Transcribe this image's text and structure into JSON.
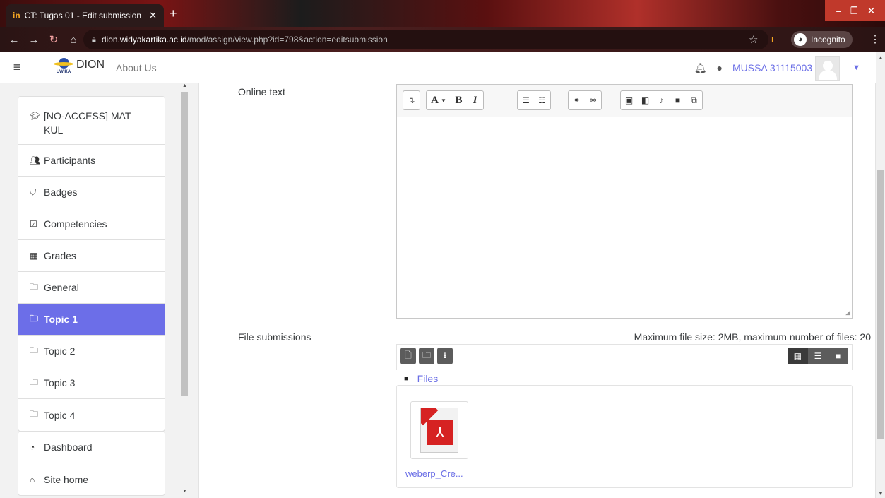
{
  "browser": {
    "tab_title": "CT: Tugas 01 - Edit submission",
    "tab_favicon": "in",
    "url_host": "dion.widyakartika.ac.id",
    "url_path": "/mod/assign/view.php?id=798&action=editsubmission",
    "incognito_label": "Incognito"
  },
  "navbar": {
    "brand": "DION",
    "logo_sub": "UWIKA",
    "about": "About Us",
    "user": "MUSSA 31115003"
  },
  "drawer": {
    "course_label": "[NO-ACCESS] MAT KUL",
    "items": [
      {
        "label": "Participants",
        "icon": "users-icon"
      },
      {
        "label": "Badges",
        "icon": "shield-icon"
      },
      {
        "label": "Competencies",
        "icon": "check-square-icon"
      },
      {
        "label": "Grades",
        "icon": "table-icon"
      },
      {
        "label": "General",
        "icon": "folder-icon"
      },
      {
        "label": "Topic 1",
        "icon": "folder-icon",
        "active": true
      },
      {
        "label": "Topic 2",
        "icon": "folder-icon"
      },
      {
        "label": "Topic 3",
        "icon": "folder-icon"
      },
      {
        "label": "Topic 4",
        "icon": "folder-icon"
      }
    ],
    "dashboard": "Dashboard",
    "site_home": "Site home"
  },
  "form": {
    "online_text_label": "Online text",
    "file_submissions_label": "File submissions",
    "max_info": "Maximum file size: 2MB, maximum number of files: 20",
    "files_path": "Files",
    "file_name": "weberp_Cre..."
  },
  "colors": {
    "accent": "#6c6ee8",
    "link": "#6a6ee6",
    "pdf_red": "#d62222"
  }
}
